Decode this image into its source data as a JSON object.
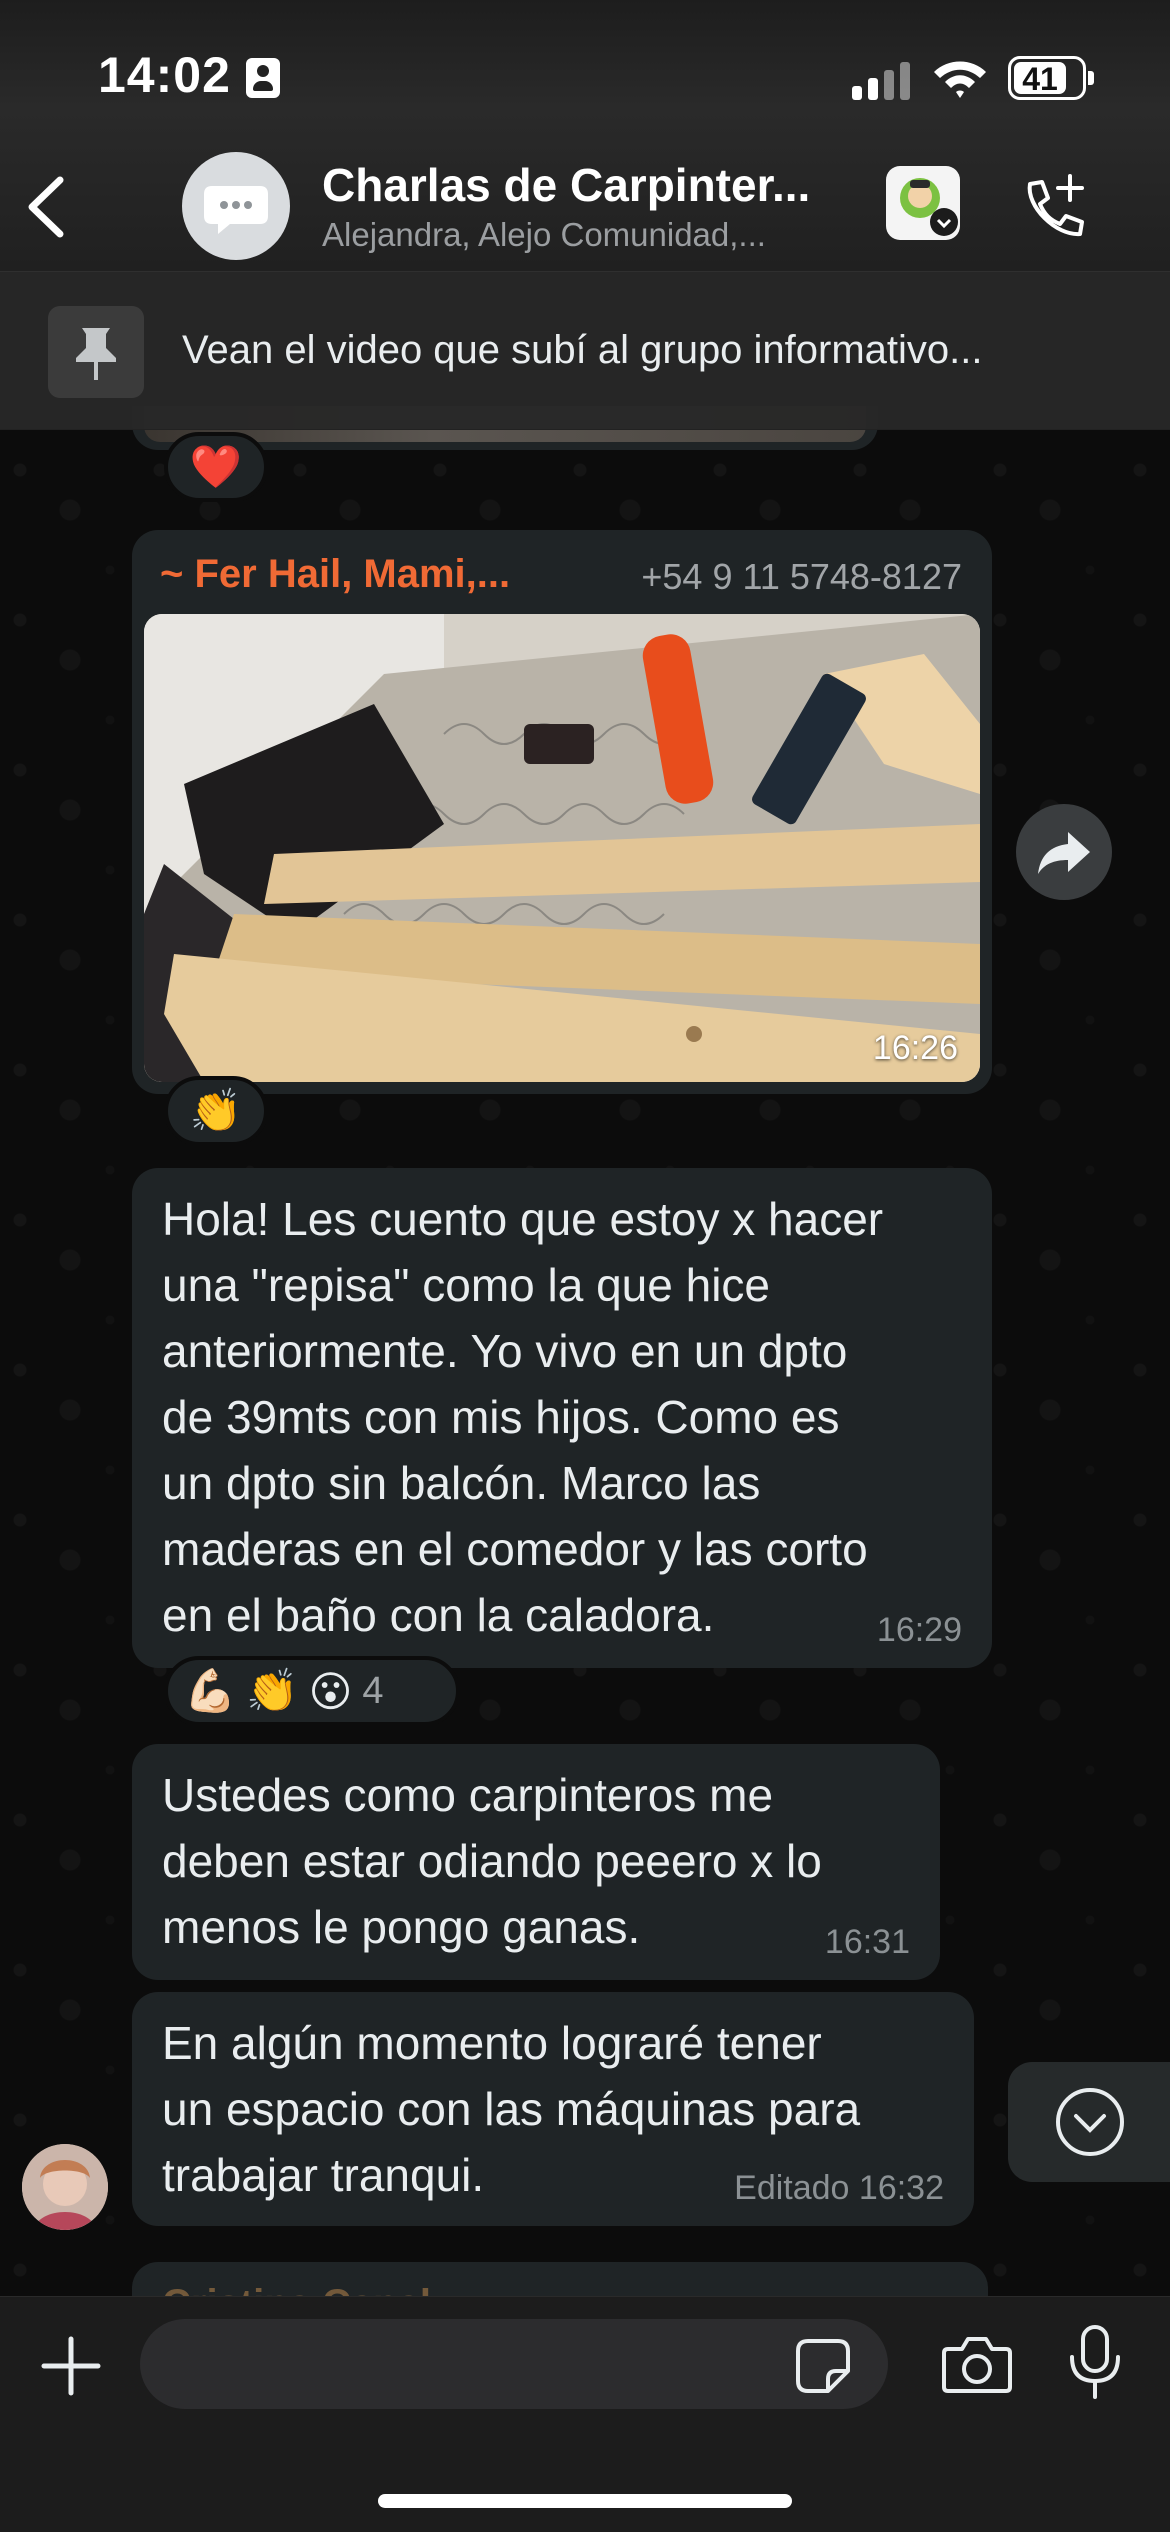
{
  "status_bar": {
    "time": "14:02",
    "battery": "41"
  },
  "header": {
    "title": "Charlas de Carpinter...",
    "subtitle": "Alejandra, Alejo Comunidad,...",
    "icons": {
      "back": "chevron-left-icon",
      "avatar": "chat-bubble-icon",
      "sticker": "sticker-icon",
      "call": "add-call-icon"
    }
  },
  "pinned": {
    "text": "Vean el video que subí al grupo informativo...",
    "icon": "pin-icon"
  },
  "messages": [
    {
      "type": "image_end",
      "reactions": [
        "❤️"
      ]
    },
    {
      "type": "image",
      "sender": "~ Fer Hail, Mami,...",
      "phone": "+54 9 11 5748-8127",
      "time": "16:26",
      "reactions": [
        "👏"
      ]
    },
    {
      "type": "text",
      "text": "Hola! Les cuento que estoy x hacer\nuna \"repisa\" como la que hice\nanteriormente. Yo vivo en un dpto\nde 39mts con mis hijos. Como es\nun dpto sin balcón. Marco las\nmaderas en el comedor y las corto\nen el baño con la caladora.",
      "time": "16:29",
      "reactions": [
        "💪🏻",
        "👏",
        "😮"
      ],
      "reaction_count": "4"
    },
    {
      "type": "text",
      "text": "Ustedes como carpinteros me\ndeben estar odiando peeero x lo\nmenos le pongo ganas.",
      "time": "16:31"
    },
    {
      "type": "text",
      "text": "En algún momento lograré tener\nun espacio con las máquinas para\ntrabajar tranqui.",
      "time": "Editado 16:32"
    }
  ],
  "next_sender": "Cristina Canal",
  "composer": {
    "placeholder": ""
  },
  "colors": {
    "bubble": "#1f2426",
    "sender_name": "#f06a35",
    "background": "#0c0c0c"
  }
}
